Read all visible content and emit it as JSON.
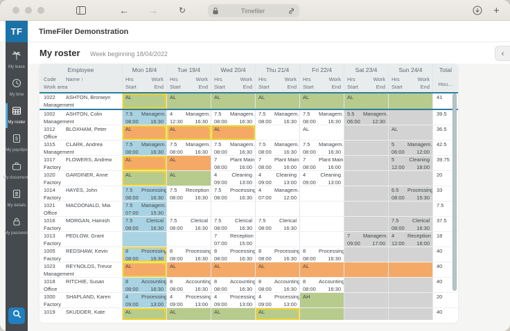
{
  "browser": {
    "address": "Timefiler",
    "icons": {
      "left": [
        "sidebar-toggle-icon",
        "back-arrow-icon",
        "forward-arrow-icon",
        "reload-icon"
      ],
      "address": [
        "lock-icon",
        "link-icon"
      ],
      "right": [
        "download-icon",
        "new-tab-icon"
      ]
    },
    "back_glyph": "←",
    "forward_glyph": "→",
    "reload_glyph": "↻",
    "plus_glyph": "+"
  },
  "app": {
    "logo_text": "TF",
    "title": "TimeFiler Demonstration"
  },
  "sidebar": {
    "items": [
      {
        "label": "My leave",
        "icon": "palm-tree-icon",
        "active": false
      },
      {
        "label": "My time",
        "icon": "clock-icon",
        "active": false
      },
      {
        "label": "My roster",
        "icon": "roster-grid-icon",
        "active": true
      },
      {
        "label": "My payslips",
        "icon": "payslip-icon",
        "active": false
      },
      {
        "label": "My documents",
        "icon": "briefcase-icon",
        "active": false
      },
      {
        "label": "My details",
        "icon": "details-page-icon",
        "active": false
      },
      {
        "label": "My password",
        "icon": "lock-icon",
        "active": false
      }
    ],
    "search_icon": "search-icon"
  },
  "page": {
    "title": "My roster",
    "subtitle": "Week beginning 18/04/2022",
    "back_glyph": "‹"
  },
  "colors": {
    "leave_green": "#b7cb8d",
    "leave_orange": "#f5a966",
    "monday_blue": "#a9d3e2",
    "weekend_gray": "#d2d3d2",
    "modified_yellow": "#efd22b",
    "selected_teal": "#2a7c9e",
    "logo_blue": "#1b72a8"
  },
  "table": {
    "employee_header": "Employee",
    "total_header": "Total",
    "total_sub": "Hou…",
    "sub_labels": {
      "code": "Code",
      "name": "Name",
      "sort_arrow": "↑",
      "work_area": "Work area",
      "hrs": "Hrs",
      "work": "Work",
      "start": "Start",
      "end": "End"
    },
    "day_headers": [
      "Mon 18/4",
      "Tue 19/4",
      "Wed 20/4",
      "Thu 21/4",
      "Fri 22/4",
      "Sat 23/4",
      "Sun 24/4"
    ],
    "rows": [
      {
        "code": "1022",
        "name": "ASHTON, Bronwyn",
        "area": "Management",
        "total": "41",
        "selected": true,
        "days": [
          {
            "bg": "green",
            "leave": "AL",
            "mod": true
          },
          {
            "bg": "green",
            "leave": "AL"
          },
          {
            "bg": "green",
            "leave": "AL"
          },
          {
            "bg": "green",
            "leave": "AL"
          },
          {
            "bg": "green",
            "leave": "AL"
          },
          {
            "bg": "green",
            "leave": "AL"
          },
          {
            "bg": "green"
          }
        ]
      },
      {
        "code": "1002",
        "name": "ASHTON, Colin",
        "area": "Management",
        "total": "39.5",
        "days": [
          {
            "bg": "blue",
            "hrs": "7.5",
            "work": "Managem…",
            "start": "08:00",
            "end": "16:30"
          },
          {
            "hrs": "4",
            "work": "Managem…",
            "start": "12:30",
            "end": "16:30"
          },
          {
            "hrs": "7.5",
            "work": "Managem…",
            "start": "08:00",
            "end": "16:30"
          },
          {
            "hrs": "7.5",
            "work": "Managem…",
            "start": "08:00",
            "end": "16:30"
          },
          {
            "hrs": "7.5",
            "work": "Managem…",
            "start": "08:00",
            "end": "16:30"
          },
          {
            "bg": "gray",
            "hrs": "5.5",
            "work": "Managem…",
            "start": "06:00",
            "end": "12:30"
          },
          {
            "bg": "gray"
          }
        ]
      },
      {
        "code": "1012",
        "name": "BLOXHAM, Peter",
        "area": "Office",
        "total": "36.5",
        "days": [
          {
            "bg": "orange",
            "leave": "AL",
            "mod": true
          },
          {
            "bg": "orange",
            "leave": "AL",
            "mod": true
          },
          {
            "bg": "orange",
            "leave": "AL",
            "mod": true
          },
          {},
          {
            "leave": "AL"
          },
          {
            "bg": "gray"
          },
          {
            "bg": "gray",
            "leave": "AL"
          }
        ]
      },
      {
        "code": "1015",
        "name": "CLARK, Andrea",
        "area": "Management",
        "total": "42.5",
        "days": [
          {
            "bg": "blue",
            "hrs": "7.5",
            "work": "Managem…",
            "start": "08:00",
            "end": "16:30"
          },
          {
            "hrs": "7.5",
            "work": "Managem…",
            "start": "08:00",
            "end": "16:30"
          },
          {
            "hrs": "7.5",
            "work": "Managem…",
            "start": "08:00",
            "end": "16:30"
          },
          {
            "hrs": "7.5",
            "work": "Managem…",
            "start": "08:00",
            "end": "16:30"
          },
          {
            "hrs": "7.5",
            "work": "Managem…",
            "start": "08:00",
            "end": "16:30"
          },
          {
            "bg": "gray"
          },
          {
            "bg": "gray",
            "hrs": "5",
            "work": "Managem…",
            "start": "06:00",
            "end": "12:00"
          }
        ]
      },
      {
        "code": "1017",
        "name": "FLOWERS, Andrew",
        "area": "Factory",
        "total": "39.75",
        "days": [
          {
            "bg": "orange",
            "leave": "AL",
            "mod": true
          },
          {
            "bg": "orange",
            "leave": "AL"
          },
          {
            "hrs": "7",
            "work": "Plant Main…",
            "start": "08:00",
            "end": "16:00"
          },
          {
            "hrs": "7",
            "work": "Plant Main…",
            "start": "08:00",
            "end": "16:00"
          },
          {
            "hrs": "7",
            "work": "Plant Main…",
            "start": "08:00",
            "end": "16:00"
          },
          {
            "bg": "gray"
          },
          {
            "bg": "gray",
            "hrs": "5",
            "work": "Cleaning",
            "start": "12:00",
            "end": "18:00"
          }
        ]
      },
      {
        "code": "1020",
        "name": "GARDINER, Anne",
        "area": "Factory",
        "total": "20",
        "days": [
          {
            "bg": "green",
            "leave": "AL",
            "mod": true
          },
          {
            "bg": "green",
            "leave": "AL"
          },
          {
            "hrs": "4",
            "work": "Cleaning",
            "start": "09:00",
            "end": "13:00"
          },
          {
            "hrs": "4",
            "work": "Cleaning",
            "start": "09:00",
            "end": "13:00"
          },
          {
            "hrs": "4",
            "work": "Cleaning",
            "start": "09:00",
            "end": "13:00"
          },
          {
            "bg": "gray"
          },
          {
            "bg": "gray"
          }
        ]
      },
      {
        "code": "1014",
        "name": "HAYES, John",
        "area": "Factory",
        "total": "33",
        "days": [
          {
            "bg": "blue",
            "hrs": "7.5",
            "work": "Processing",
            "start": "08:00",
            "end": "16:30"
          },
          {
            "hrs": "7.5",
            "work": "Reception",
            "start": "08:00",
            "end": "16:30"
          },
          {
            "hrs": "7.5",
            "work": "Processing",
            "start": "08:00",
            "end": "16:30"
          },
          {
            "hrs": "4",
            "work": "Managem…",
            "start": "07:00",
            "end": "12:00"
          },
          {},
          {
            "bg": "gray"
          },
          {
            "bg": "gray",
            "hrs": "6.5",
            "work": "Processing",
            "start": "08:00",
            "end": "15:30"
          }
        ]
      },
      {
        "code": "1021",
        "name": "MACDONALD, Mia",
        "area": "Office",
        "total": "7.5",
        "days": [
          {
            "bg": "blue",
            "hrs": "7.5",
            "work": "Managem…",
            "start": "07:00",
            "end": "15:30"
          },
          {},
          {},
          {},
          {},
          {
            "bg": "gray"
          },
          {
            "bg": "gray"
          }
        ]
      },
      {
        "code": "1016",
        "name": "MORGAN, Hamish",
        "area": "Factory",
        "total": "37.5",
        "days": [
          {
            "bg": "blue",
            "hrs": "7.5",
            "work": "Clerical",
            "start": "08:00",
            "end": "16:30"
          },
          {
            "hrs": "7.5",
            "work": "Clerical",
            "start": "08:00",
            "end": "16:30"
          },
          {
            "hrs": "7.5",
            "work": "Clerical",
            "start": "08:00",
            "end": "16:30"
          },
          {
            "hrs": "7.5",
            "work": "Clerical",
            "start": "08:00",
            "end": "16:30"
          },
          {},
          {
            "bg": "gray"
          },
          {
            "bg": "gray",
            "hrs": "7.5",
            "work": "Clerical",
            "start": "08:00",
            "end": "16:30"
          }
        ]
      },
      {
        "code": "1013",
        "name": "PEDLOW, Grant",
        "area": "Factory",
        "total": "18",
        "days": [
          {
            "bg": "blue"
          },
          {},
          {
            "hrs": "7",
            "work": "Reception",
            "start": "07:00",
            "end": "15:00"
          },
          {},
          {},
          {
            "bg": "gray",
            "hrs": "7",
            "work": "Managem…",
            "start": "09:00",
            "end": "17:00"
          },
          {
            "bg": "gray",
            "hrs": "4",
            "work": "Reception",
            "start": "12:00",
            "end": "16:00"
          }
        ]
      },
      {
        "code": "1005",
        "name": "REDSHAW, Kevin",
        "area": "Factory",
        "total": "40",
        "days": [
          {
            "bg": "blue",
            "hrs": "8",
            "work": "Processing",
            "start": "08:00",
            "end": "16:30",
            "mod": true
          },
          {
            "hrs": "8",
            "work": "Processing",
            "start": "08:00",
            "end": "16:30"
          },
          {
            "hrs": "8",
            "work": "Processing",
            "start": "08:00",
            "end": "16:30"
          },
          {
            "hrs": "8",
            "work": "Processing",
            "start": "08:00",
            "end": "16:30"
          },
          {
            "hrs": "8",
            "work": "Processing",
            "start": "08:00",
            "end": "16:30"
          },
          {
            "bg": "gray"
          },
          {
            "bg": "gray"
          }
        ]
      },
      {
        "code": "1023",
        "name": "REYNOLDS, Trevor",
        "area": "Management",
        "total": "40",
        "days": [
          {
            "bg": "orange",
            "leave": "AL",
            "mod": true
          },
          {
            "bg": "orange",
            "leave": "AL"
          },
          {
            "bg": "orange",
            "leave": "AL"
          },
          {
            "bg": "orange",
            "leave": "AL"
          },
          {
            "bg": "orange",
            "leave": "AL"
          },
          {
            "bg": "orange"
          },
          {
            "bg": "orange"
          }
        ]
      },
      {
        "code": "1018",
        "name": "RITCHIE, Susan",
        "area": "Office",
        "total": "40",
        "days": [
          {
            "bg": "blue",
            "hrs": "8",
            "work": "Accounting",
            "start": "08:00",
            "end": "16:30"
          },
          {
            "hrs": "8",
            "work": "Accounting",
            "start": "08:00",
            "end": "16:30"
          },
          {
            "hrs": "8",
            "work": "Accounting",
            "start": "08:00",
            "end": "16:30"
          },
          {
            "hrs": "8",
            "work": "Accounting",
            "start": "08:00",
            "end": "16:30"
          },
          {
            "hrs": "8",
            "work": "Accounting",
            "start": "08:00",
            "end": "16:30"
          },
          {
            "bg": "gray"
          },
          {
            "bg": "gray"
          }
        ]
      },
      {
        "code": "1000",
        "name": "SHAPLAND, Karen",
        "area": "Factory",
        "total": "20",
        "days": [
          {
            "bg": "blue",
            "hrs": "4",
            "work": "Processing",
            "start": "09:00",
            "end": "13:00"
          },
          {
            "hrs": "4",
            "work": "Processing",
            "start": "09:00",
            "end": "13:00"
          },
          {
            "hrs": "4",
            "work": "Processing",
            "start": "09:00",
            "end": "13:00"
          },
          {
            "hrs": "4",
            "work": "Processing",
            "start": "09:00",
            "end": "13:00"
          },
          {
            "bg": "green",
            "leave": "AH"
          },
          {
            "bg": "gray"
          },
          {
            "bg": "gray"
          }
        ]
      },
      {
        "code": "1019",
        "name": "SKUDDER, Kate",
        "area": "",
        "total": "40",
        "partial": true,
        "days": [
          {
            "bg": "green",
            "leave": "AL",
            "mod": true
          },
          {
            "bg": "green",
            "leave": "AL"
          },
          {
            "bg": "green",
            "leave": "AL"
          },
          {
            "bg": "green",
            "leave": "AL",
            "mod": true
          },
          {
            "bg": "green"
          },
          {
            "bg": "gray"
          },
          {
            "bg": "gray"
          }
        ]
      }
    ]
  }
}
